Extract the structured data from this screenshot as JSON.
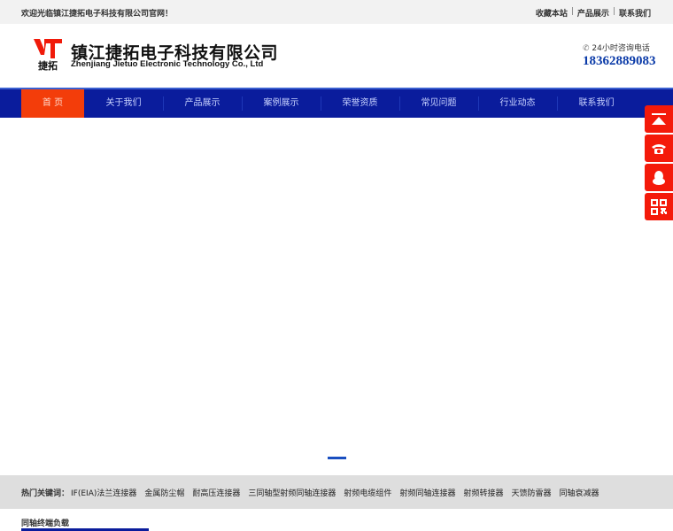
{
  "topbar": {
    "welcome": "欢迎光临镇江捷拓电子科技有限公司官网！",
    "links": [
      "收藏本站",
      "产品展示",
      "联系我们"
    ],
    "separator": "|"
  },
  "header": {
    "logo_text": "捷拓",
    "company_cn": "镇江捷拓电子科技有限公司",
    "company_en": "Zhenjiang Jietuo Electronic Technology Co., Ltd",
    "hotline_label": "24小时咨询电话",
    "hotline": "18362889083"
  },
  "nav": {
    "items": [
      "首 页",
      "关于我们",
      "产品展示",
      "案例展示",
      "荣誉资质",
      "常见问题",
      "行业动态",
      "联系我们"
    ],
    "active": 0
  },
  "colors": {
    "nav": "#0a1c9c",
    "active": "#f33d0a",
    "side": "#f41a0a",
    "phone": "#0a3aa8"
  },
  "keywords": {
    "label": "热门关键词：",
    "items": [
      "IF(EIA)法兰连接器",
      "金属防尘帽",
      "耐高压连接器",
      "三同轴型射频同轴连接器",
      "射频电缆组件",
      "射频同轴连接器",
      "射频转接器",
      "天馈防雷器",
      "同轴衰减器"
    ]
  },
  "section": {
    "title": "同轴终端负载"
  }
}
